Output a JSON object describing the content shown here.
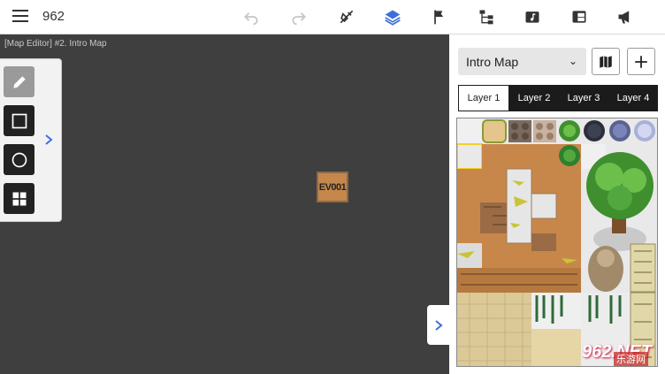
{
  "header": {
    "title": "962",
    "icons": [
      "menu-icon",
      "undo-icon",
      "redo-icon",
      "eraser-icon",
      "layers-icon",
      "flag-icon",
      "tree-icon",
      "music-icon",
      "window-icon",
      "megaphone-icon"
    ]
  },
  "canvas": {
    "label": "[Map Editor] #2. Intro Map",
    "event_label": "EV001"
  },
  "tools": [
    "pencil-tool",
    "rectangle-tool",
    "ellipse-tool",
    "fill-tool"
  ],
  "sidebar": {
    "map_name": "Intro Map",
    "tabs": [
      "Layer 1",
      "Layer 2",
      "Layer 3",
      "Layer 4"
    ],
    "active_tab": "Layer 1"
  },
  "watermark": {
    "main": "962.NET",
    "sub": "乐游网"
  },
  "colors": {
    "accent": "#3d6fd8",
    "canvas": "#3f3f3f",
    "tab_bar": "#1b1b1b"
  }
}
